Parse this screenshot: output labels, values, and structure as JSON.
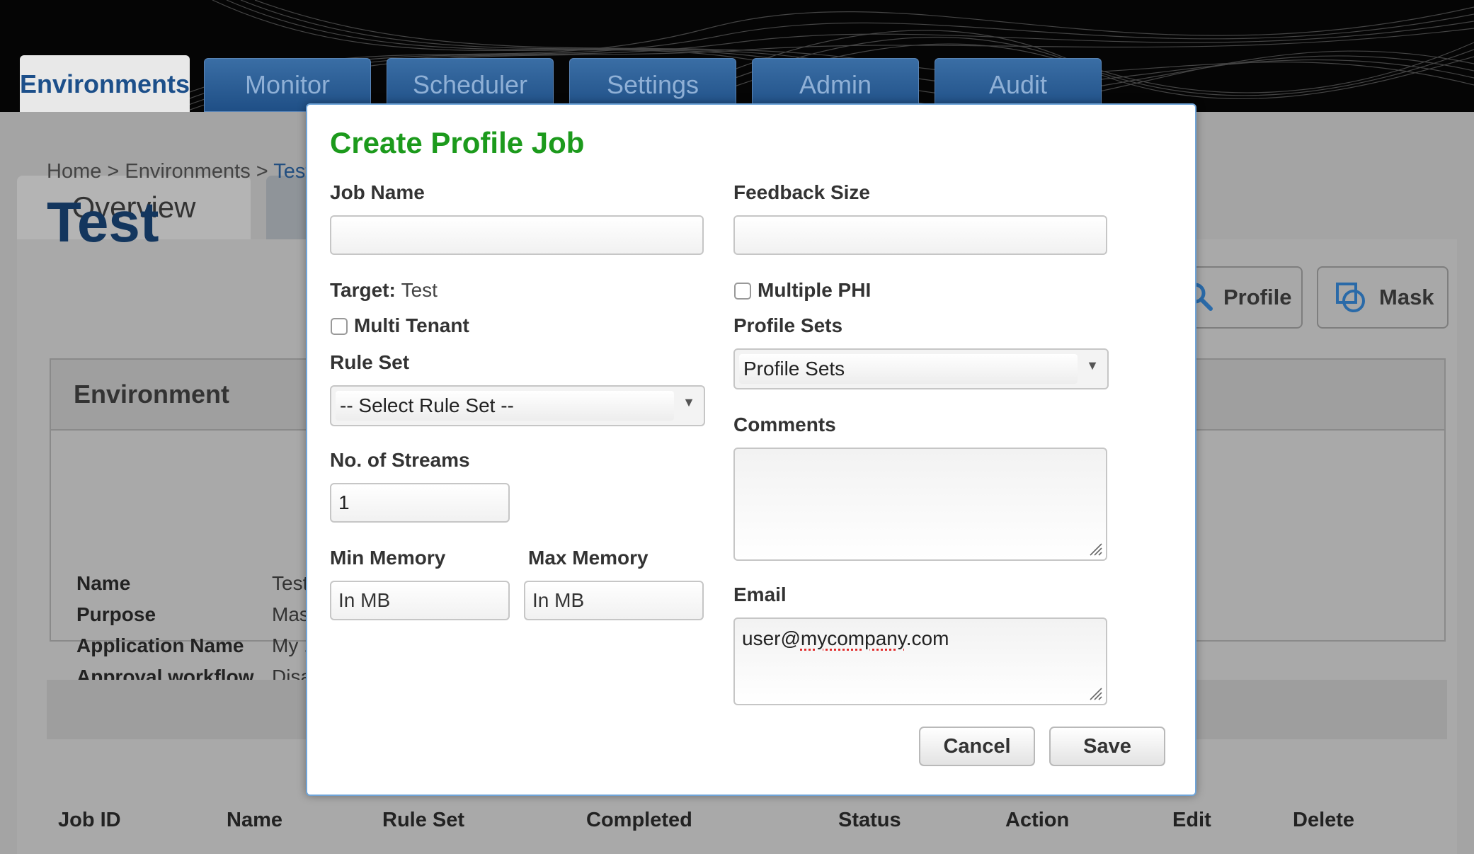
{
  "nav": {
    "tabs": [
      {
        "label": "Environments",
        "active": true
      },
      {
        "label": "Monitor",
        "active": false
      },
      {
        "label": "Scheduler",
        "active": false
      },
      {
        "label": "Settings",
        "active": false
      },
      {
        "label": "Admin",
        "active": false
      },
      {
        "label": "Audit",
        "active": false
      }
    ]
  },
  "page": {
    "subtab_overview": "Overview",
    "breadcrumb": {
      "home": "Home",
      "sep1": " > ",
      "environments": "Environments",
      "sep2": " > ",
      "current": "Test"
    },
    "title": "Test",
    "actions": {
      "profile": "Profile",
      "mask": "Mask"
    },
    "environment_panel": {
      "heading": "Environment",
      "rows": [
        {
          "label": "Name",
          "value": "Test"
        },
        {
          "label": "Purpose",
          "value": "Mas"
        },
        {
          "label": "Application Name",
          "value": "My ."
        },
        {
          "label": "Approval workflow",
          "value": "Disa"
        }
      ]
    },
    "table_headers": [
      "Job ID",
      "Name",
      "Rule Set",
      "Completed",
      "Status",
      "Action",
      "Edit",
      "Delete"
    ]
  },
  "modal": {
    "title": "Create Profile Job",
    "job_name": {
      "label": "Job Name",
      "value": ""
    },
    "feedback_size": {
      "label": "Feedback Size",
      "value": ""
    },
    "target": {
      "label": "Target:",
      "value": "Test"
    },
    "multiple_phi": {
      "label": "Multiple PHI",
      "checked": false
    },
    "multi_tenant": {
      "label": "Multi Tenant",
      "checked": false
    },
    "profile_sets": {
      "label": "Profile Sets",
      "selected": "Profile Sets"
    },
    "rule_set": {
      "label": "Rule Set",
      "selected": "-- Select Rule Set --"
    },
    "comments": {
      "label": "Comments",
      "value": ""
    },
    "streams": {
      "label": "No. of Streams",
      "value": "1"
    },
    "min_memory": {
      "label": "Min Memory",
      "placeholder": "In MB"
    },
    "max_memory": {
      "label": "Max Memory",
      "placeholder": "In MB"
    },
    "email": {
      "label": "Email",
      "value_prefix": "user@",
      "value_misspelled": "mycompany",
      "value_suffix": ".com"
    },
    "buttons": {
      "cancel": "Cancel",
      "save": "Save"
    }
  },
  "icons": {
    "dropdown_arrow": "▼"
  },
  "colors": {
    "title_green": "#1c9a1c",
    "tab_blue": "#2a5f98",
    "title_navy": "#13365e",
    "link_blue": "#234f80"
  }
}
